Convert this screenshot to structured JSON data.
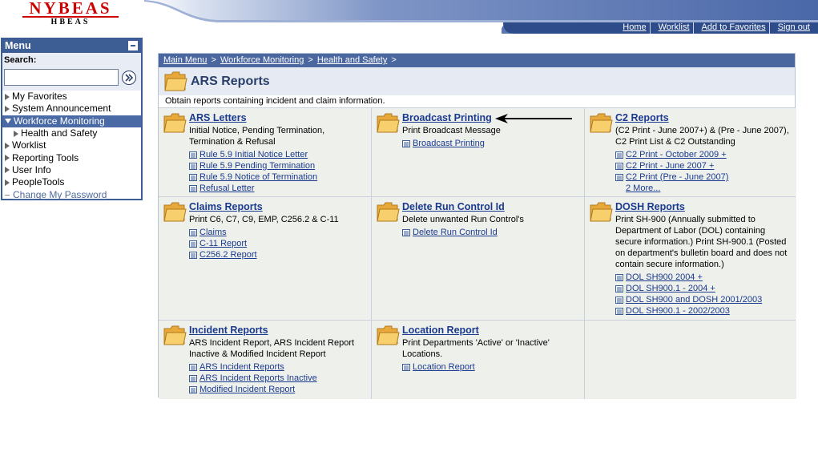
{
  "logo": {
    "line1": "NYBEAS",
    "line2": "HBEAS"
  },
  "topnav": [
    "Home",
    "Worklist",
    "Add to Favorites",
    "Sign out"
  ],
  "menu": {
    "title": "Menu",
    "search_label": "Search:",
    "search_value": "",
    "items": [
      {
        "label": "My Favorites"
      },
      {
        "label": "System Announcement"
      },
      {
        "label": "Workforce Monitoring"
      },
      {
        "label": "Health and Safety"
      },
      {
        "label": "Worklist"
      },
      {
        "label": "Reporting Tools"
      },
      {
        "label": "User Info"
      },
      {
        "label": "PeopleTools"
      },
      {
        "label": "Change My Password"
      }
    ]
  },
  "breadcrumb": [
    "Main Menu",
    "Workforce Monitoring",
    "Health and Safety"
  ],
  "breadcrumb_sep": ">",
  "page": {
    "title": "ARS Reports",
    "description": "Obtain reports containing incident and claim information."
  },
  "cells": [
    {
      "title": "ARS Letters",
      "desc": "Initial Notice, Pending Termination, Termination & Refusal",
      "links": [
        "Rule 5.9 Initial Notice Letter",
        "Rule 5.9 Pending Termination",
        "Rule 5.9 Notice of Termination",
        "Refusal Letter"
      ]
    },
    {
      "title": "Broadcast Printing",
      "desc": "Print Broadcast Message",
      "links": [
        "Broadcast Printing"
      ]
    },
    {
      "title": "C2 Reports",
      "desc": "(C2 Print - June 2007+) & (Pre - June 2007), C2 Print List & C2 Outstanding",
      "links": [
        "C2 Print - October 2009 +",
        "C2 Print - June 2007 +",
        "C2 Print (Pre - June 2007)"
      ],
      "more": "2 More..."
    },
    {
      "title": "Claims Reports",
      "desc": "Print C6, C7, C9, EMP, C256.2 & C-11",
      "links": [
        "Claims",
        "C-11 Report",
        "C256.2 Report"
      ]
    },
    {
      "title": "Delete Run Control Id",
      "desc": "Delete unwanted Run Control's",
      "links": [
        "Delete Run Control Id"
      ]
    },
    {
      "title": "DOSH Reports",
      "desc": "Print SH-900 (Annually submitted to Department of Labor (DOL) containing secure information.) Print SH-900.1 (Posted on department's bulletin board and does not contain secure information.)",
      "links": [
        "DOL SH900 2004 +",
        "DOL SH900.1 - 2004 +",
        "DOL SH900 and DOSH 2001/2003",
        "DOL SH900.1 - 2002/2003"
      ]
    },
    {
      "title": "Incident Reports",
      "desc": "ARS Incident Report, ARS Incident Report Inactive & Modified Incident Report",
      "links": [
        "ARS Incident Reports",
        "ARS Incident Reports Inactive",
        "Modified Incident Report"
      ]
    },
    {
      "title": "Location Report",
      "desc": "Print Departments 'Active' or 'Inactive' Locations.",
      "links": [
        "Location Report"
      ]
    }
  ],
  "colors": {
    "brand": "#cc0000",
    "header_blue": "#4a67a0",
    "link": "#1a3a8f",
    "folder": "#f2c35a"
  }
}
